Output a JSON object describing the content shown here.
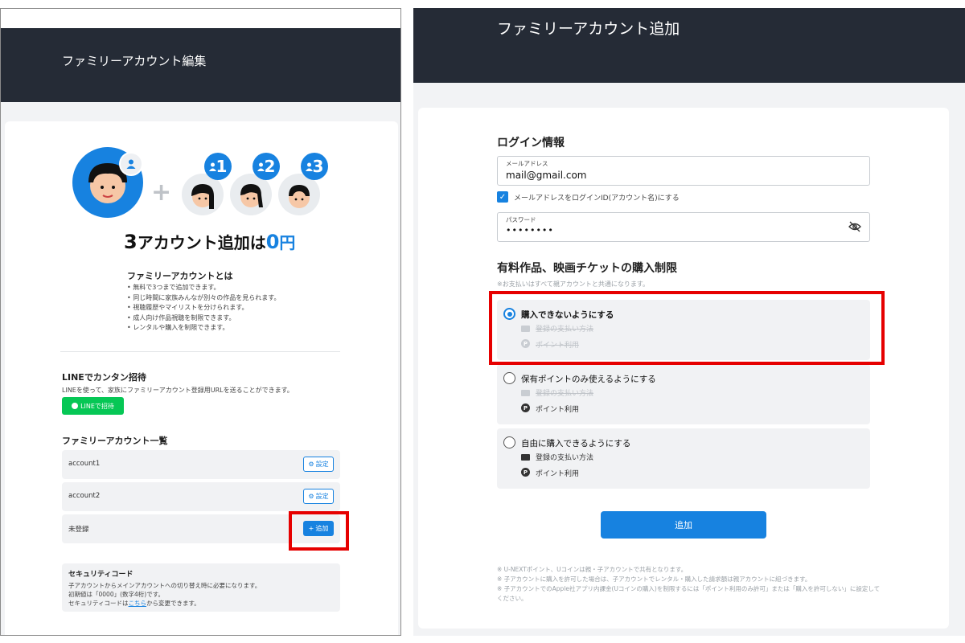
{
  "left": {
    "header_title": "ファミリーアカウント編集",
    "promo": {
      "number": "3",
      "text": "アカウント追加は",
      "price": "0",
      "unit": "円"
    },
    "badges": [
      "1",
      "2",
      "3"
    ],
    "about_heading": "ファミリーアカウントとは",
    "about_items": [
      "無料で3つまで追加できます。",
      "同じ時間に家族みんなが別々の作品を見られます。",
      "視聴履歴やマイリストを分けられます。",
      "成人向け作品視聴を制限できます。",
      "レンタルや購入を制限できます。"
    ],
    "line_heading": "LINEでカンタン招待",
    "line_desc": "LINEを使って、家族にファミリーアカウント登録用URLを送ることができます。",
    "line_button": "LINEで招待",
    "list_heading": "ファミリーアカウント一覧",
    "accounts": [
      {
        "name": "account1",
        "action": "設定"
      },
      {
        "name": "account2",
        "action": "設定"
      },
      {
        "name": "未登録",
        "action": "追加"
      }
    ],
    "security": {
      "title": "セキュリティコード",
      "line1": "子アカウントからメインアカウントへの切り替え時に必要になります。",
      "line2": "初期値は「0000」(数字4桁)です。",
      "line3_pre": "セキュリティコードは",
      "line3_link": "こちら",
      "line3_post": "から変更できます。"
    }
  },
  "right": {
    "header_title": "ファミリーアカウント追加",
    "login_heading": "ログイン情報",
    "email": {
      "label": "メールアドレス",
      "value": "mail@gmail.com"
    },
    "use_email_checkbox": {
      "label": "メールアドレスをログインID(アカウント名)にする",
      "checked": true
    },
    "password": {
      "label": "パスワード",
      "value": "••••••••"
    },
    "purchase_heading": "有料作品、映画チケットの購入制限",
    "purchase_note": "※お支払いはすべて親アカウントと共通になります。",
    "options": [
      {
        "label": "購入できないようにする",
        "selected": true,
        "sub1": "登録の支払い方法",
        "sub2": "ポイント利用",
        "sub1_disabled": true,
        "sub2_disabled": true
      },
      {
        "label": "保有ポイントのみ使えるようにする",
        "selected": false,
        "sub1": "登録の支払い方法",
        "sub2": "ポイント利用",
        "sub1_disabled": true,
        "sub2_disabled": false
      },
      {
        "label": "自由に購入できるようにする",
        "selected": false,
        "sub1": "登録の支払い方法",
        "sub2": "ポイント利用",
        "sub1_disabled": false,
        "sub2_disabled": false
      }
    ],
    "submit_label": "追加",
    "footnotes": [
      "※ U-NEXTポイント、Uコインは親・子アカウントで共有となります。",
      "※ 子アカウントに購入を許可した場合は、子アカウントでレンタル・購入した請求額は親アカウントに紐づきます。",
      "※ 子アカウントでのApple社アプリ内課金(Uコインの購入)を制限するには「ポイント利用のみ許可」または「購入を許可しない」に設定して",
      "ください。"
    ]
  },
  "colors": {
    "accent": "#1782e0",
    "header": "#252b36",
    "highlight": "#e60000",
    "line_green": "#06c755"
  },
  "icons": [
    "user-icon",
    "gear-icon",
    "plus-icon",
    "line-logo-icon",
    "eye-off-icon",
    "card-icon",
    "point-icon",
    "check-icon"
  ]
}
